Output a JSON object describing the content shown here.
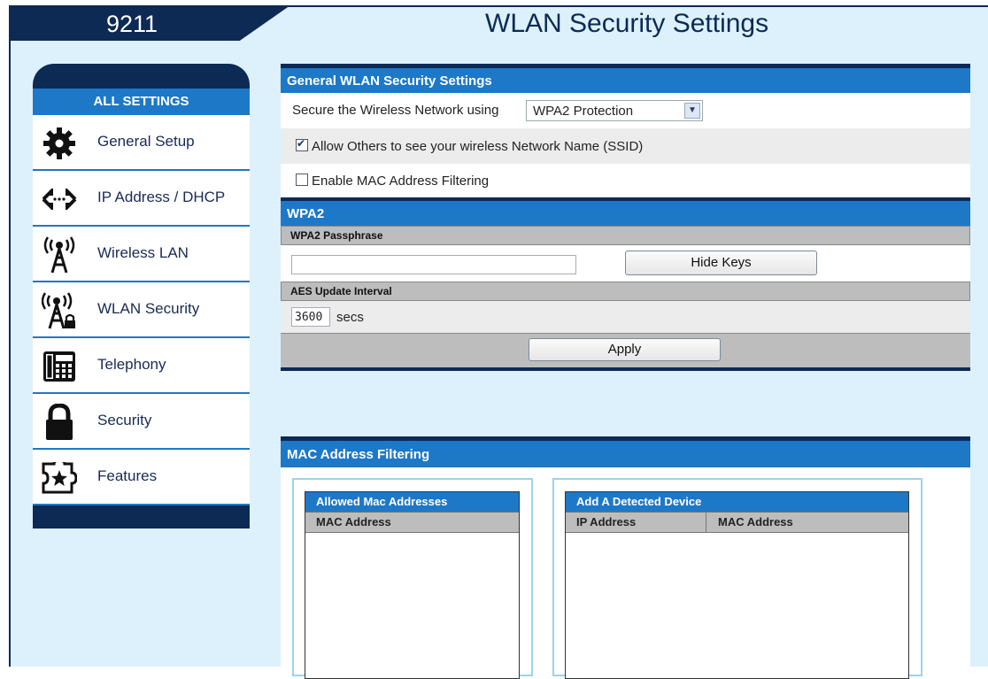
{
  "header": {
    "model": "9211",
    "title": "WLAN Security Settings"
  },
  "sidebar": {
    "heading": "ALL SETTINGS",
    "items": [
      {
        "label": "General Setup",
        "icon": "gear-icon"
      },
      {
        "label": "IP Address / DHCP",
        "icon": "network-arrows-icon"
      },
      {
        "label": "Wireless LAN",
        "icon": "wireless-tower-icon"
      },
      {
        "label": "WLAN Security",
        "icon": "wireless-lock-icon"
      },
      {
        "label": "Telephony",
        "icon": "desk-phone-icon"
      },
      {
        "label": "Security",
        "icon": "padlock-icon"
      },
      {
        "label": "Features",
        "icon": "puzzle-star-icon"
      }
    ]
  },
  "general": {
    "heading": "General WLAN Security Settings",
    "secure_label": "Secure the Wireless Network using",
    "protection_value": "WPA2 Protection",
    "ssid_label": "Allow Others to see your wireless Network Name (SSID)",
    "ssid_checked": true,
    "mac_filter_label": "Enable MAC Address Filtering",
    "mac_filter_checked": false
  },
  "wpa2": {
    "heading": "WPA2",
    "passphrase_heading": "WPA2 Passphrase",
    "passphrase_value": "",
    "hide_keys_label": "Hide Keys",
    "aes_heading": "AES Update Interval",
    "aes_value": "3600",
    "aes_unit": "secs",
    "apply_label": "Apply"
  },
  "mac_filtering": {
    "heading": "MAC Address Filtering",
    "allowed": {
      "heading": "Allowed Mac Addresses",
      "columns": [
        "MAC Address"
      ]
    },
    "detected": {
      "heading": "Add A Detected Device",
      "columns": [
        "IP Address",
        "MAC Address"
      ]
    }
  },
  "colors": {
    "navy": "#0d2a55",
    "blue": "#1e78c8",
    "background": "#dcf1fb",
    "gray_bar": "#bdbdbd"
  }
}
